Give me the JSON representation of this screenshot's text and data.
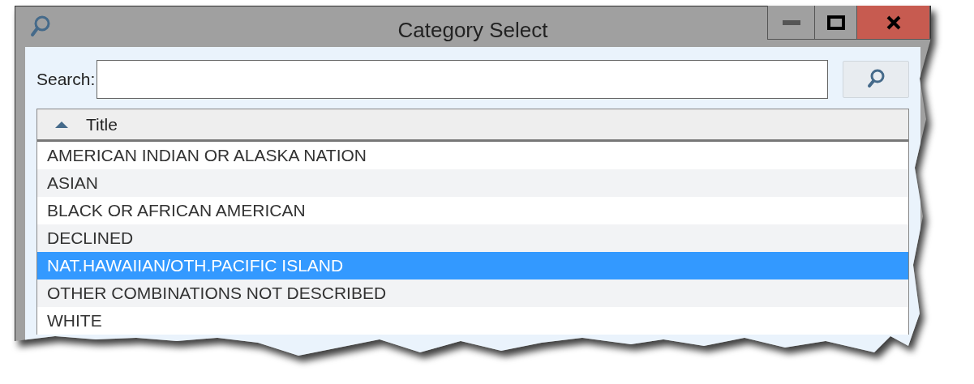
{
  "window": {
    "title": "Category Select"
  },
  "search": {
    "label": "Search:"
  },
  "table": {
    "columns": [
      {
        "title": "Title",
        "sort_ascending": true
      }
    ],
    "rows": [
      {
        "title": "AMERICAN INDIAN OR ALASKA NATION",
        "selected": false
      },
      {
        "title": "ASIAN",
        "selected": false
      },
      {
        "title": "BLACK OR AFRICAN AMERICAN",
        "selected": false
      },
      {
        "title": "DECLINED",
        "selected": false
      },
      {
        "title": "NAT.HAWAIIAN/OTH.PACIFIC ISLAND",
        "selected": true
      },
      {
        "title": "OTHER COMBINATIONS NOT DESCRIBED",
        "selected": false
      },
      {
        "title": "WHITE",
        "selected": false
      }
    ]
  }
}
